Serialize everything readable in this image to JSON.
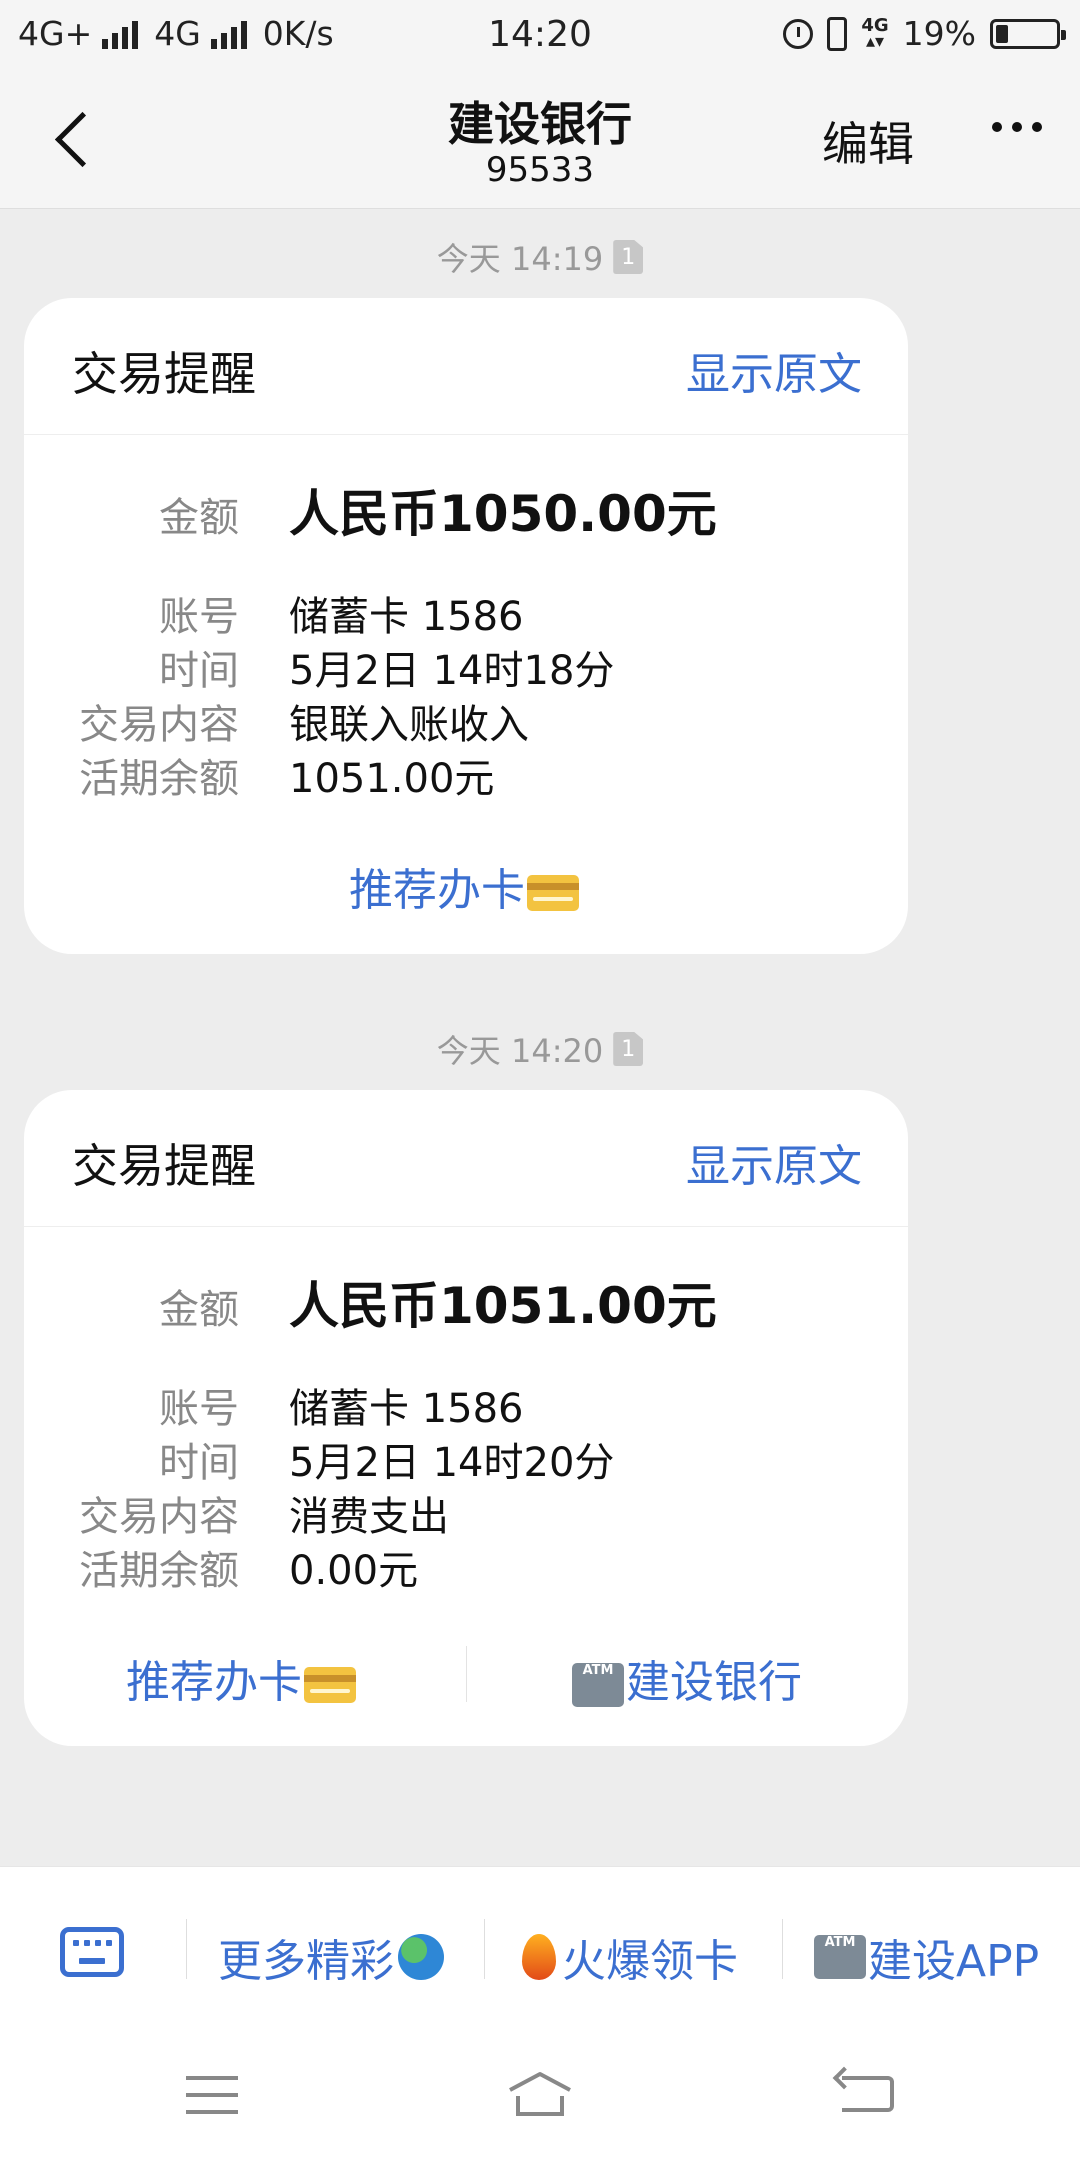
{
  "status_bar": {
    "network1": "4G+",
    "network2": "4G",
    "speed": "0K/s",
    "time": "14:20",
    "net_badge": "4G",
    "battery": "19%"
  },
  "header": {
    "title": "建设银行",
    "number": "95533",
    "edit_label": "编辑"
  },
  "messages": [
    {
      "timestamp": "今天 14:19",
      "sim": "1",
      "card_title": "交易提醒",
      "show_original": "显示原文",
      "amount_label": "金额",
      "amount_value": "人民币1050.00元",
      "account_label": "账号",
      "account_value": "储蓄卡 1586",
      "time_label": "时间",
      "time_value": "5月2日 14时18分",
      "content_label": "交易内容",
      "content_value": "银联入账收入",
      "balance_label": "活期余额",
      "balance_value": "1051.00元",
      "recommend": "推荐办卡"
    },
    {
      "timestamp": "今天 14:20",
      "sim": "1",
      "card_title": "交易提醒",
      "show_original": "显示原文",
      "amount_label": "金额",
      "amount_value": "人民币1051.00元",
      "account_label": "账号",
      "account_value": "储蓄卡 1586",
      "time_label": "时间",
      "time_value": "5月2日 14时20分",
      "content_label": "交易内容",
      "content_value": "消费支出",
      "balance_label": "活期余额",
      "balance_value": "0.00元",
      "recommend": "推荐办卡",
      "bank_link": "建设银行"
    }
  ],
  "menu": {
    "item1": "更多精彩",
    "item2": "火爆领卡",
    "item3": "建设APP",
    "atm_text": "ATM"
  },
  "colors": {
    "accent": "#3b6fd0",
    "background": "#ededed",
    "card": "#ffffff"
  }
}
